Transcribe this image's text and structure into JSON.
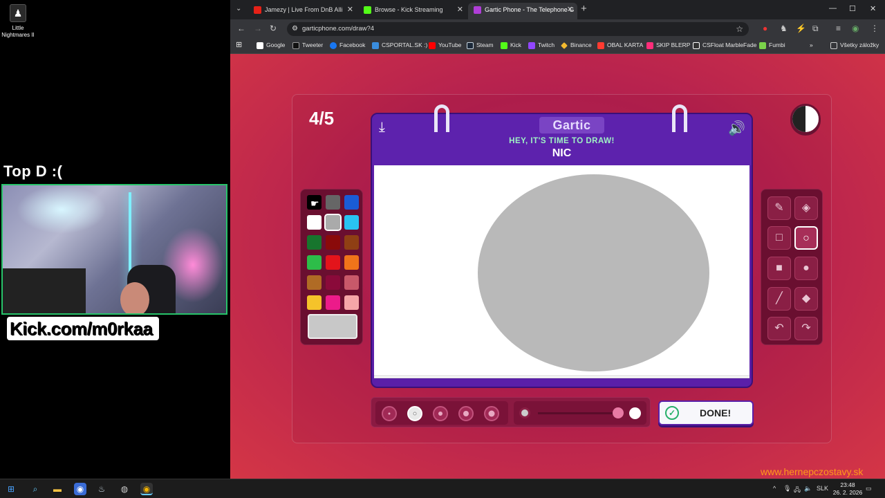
{
  "desktop": {
    "icon_label": "Little Nightmares II"
  },
  "stream": {
    "overlay_title": "Top D :(",
    "channel_link": "Kick.com/m0rkaa"
  },
  "browser": {
    "tabs": [
      {
        "title": "Jamezy | Live From DnB Alli",
        "color": "#e62117"
      },
      {
        "title": "Browse - Kick Streaming",
        "color": "#53fc18"
      },
      {
        "title": "Gartic Phone - The Telephone G",
        "color": "#b03ed8"
      }
    ],
    "url": "garticphone.com/draw?4",
    "bookmarks": [
      {
        "label": "Google",
        "color": "#ffffff"
      },
      {
        "label": "Tweeter",
        "color": "#222222"
      },
      {
        "label": "Facebook",
        "color": "#1877f2"
      },
      {
        "label": "CSPORTAL.SK :)",
        "color": "#3a8dde"
      },
      {
        "label": "YouTube",
        "color": "#ff0000"
      },
      {
        "label": "Steam",
        "color": "#c7d5e0"
      },
      {
        "label": "Kick",
        "color": "#53fc18"
      },
      {
        "label": "Twitch",
        "color": "#9146ff"
      },
      {
        "label": "Binance",
        "color": "#f3ba2f"
      },
      {
        "label": "OBAL KARTA",
        "color": "#ff3b30"
      },
      {
        "label": "SKIP BLERP",
        "color": "#ff2d7a"
      },
      {
        "label": "CSFloat MarbleFade",
        "color": "#ffffff"
      },
      {
        "label": "Fumbi",
        "color": "#7ad34a"
      }
    ],
    "all_bookmarks_label": "Všetky záložky"
  },
  "game": {
    "round_counter": "4/5",
    "logo": "Gartic",
    "prompt_heading": "HEY, IT'S TIME TO DRAW!",
    "word": "NIC",
    "done_label": "DONE!",
    "palette": [
      "#000000",
      "#666666",
      "#1a5cd6",
      "#ffffff",
      "#aaaaaa",
      "#29c4f2",
      "#17752d",
      "#8a0a0a",
      "#8f3f14",
      "#2dbd49",
      "#e3141b",
      "#f0741a",
      "#b06b25",
      "#8a0a3a",
      "#c8596a",
      "#f5c32a",
      "#ec1b8a",
      "#f5a6a8"
    ],
    "selected_color": "#c8c8c8",
    "watermark": "www.hernepczostavy.sk"
  },
  "taskbar": {
    "language": "SLK",
    "time": "23:48",
    "date": "26. 2. 2026"
  }
}
